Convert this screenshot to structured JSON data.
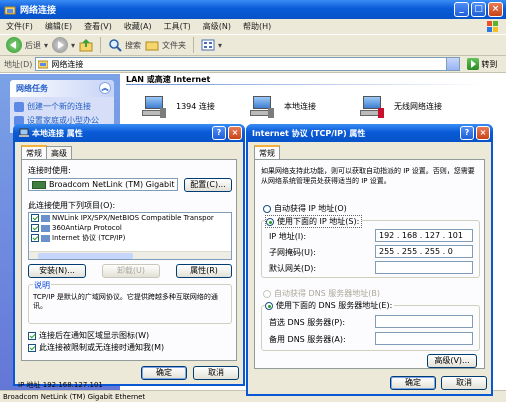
{
  "explorer": {
    "title": "网络连接",
    "menu": [
      "文件(F)",
      "编辑(E)",
      "查看(V)",
      "收藏(A)",
      "工具(T)",
      "高级(N)",
      "帮助(H)"
    ],
    "toolbar": {
      "back": "后退",
      "search": "搜索",
      "folders": "文件夹"
    },
    "address": {
      "label": "地址(D)",
      "value": "网络连接",
      "go": "转到"
    },
    "taskpane": {
      "title": "网络任务",
      "links": [
        "创建一个新的连接",
        "设置家庭或小型办公"
      ]
    },
    "group_header": "LAN 或高速 Internet",
    "connections": [
      "1394 连接",
      "本地连接",
      "无线网络连接"
    ],
    "statusbar": "Broadcom NetLink (TM) Gigabit Ethernet"
  },
  "lanprops": {
    "title": "本地连接 属性",
    "tabs": [
      "常规",
      "高级"
    ],
    "connect_using_label": "连接时使用:",
    "adapter": "Broadcom NetLink (TM) Gigabit",
    "configure": "配置(C)...",
    "items_label": "此连接使用下列项目(O):",
    "items": [
      "NWLink IPX/SPX/NetBIOS Compatible Transpor",
      "360AntiArp Protocol",
      "Internet 协议 (TCP/IP)"
    ],
    "install": "安装(N)...",
    "uninstall": "卸载(U)",
    "properties": "属性(R)",
    "desc_label": "说明",
    "desc_text": "TCP/IP 是默认的广域网协议。它提供跨越多种互联网络的通讯。",
    "chk_show_icon": "连接后在通知区域显示图标(W)",
    "chk_notify": "此连接被限制或无连接时通知我(M)",
    "ok": "确定",
    "cancel": "取消",
    "bottom_text": "IP 地址 192.168.127.101"
  },
  "tcpip": {
    "title": "Internet 协议 (TCP/IP) 属性",
    "tab": "常规",
    "intro": "如果网络支持此功能，则可以获取自动指派的 IP 设置。否则，您需要从网络系统管理员处获得适当的 IP 设置。",
    "auto_ip": "自动获得 IP 地址(O)",
    "use_ip": "使用下面的 IP 地址(S):",
    "ip_label": "IP 地址(I):",
    "ip_value": "192 . 168 . 127 . 101",
    "mask_label": "子网掩码(U):",
    "mask_value": "255 . 255 . 255 .  0",
    "gw_label": "默认网关(D):",
    "auto_dns": "自动获得 DNS 服务器地址(B)",
    "use_dns": "使用下面的 DNS 服务器地址(E):",
    "dns1_label": "首选 DNS 服务器(P):",
    "dns2_label": "备用 DNS 服务器(A):",
    "advanced": "高级(V)...",
    "ok": "确定",
    "cancel": "取消"
  },
  "colors": {
    "xp_blue": "#0a5bd8",
    "dialog_bg": "#ece9d8",
    "task_blue": "#215dc6"
  }
}
